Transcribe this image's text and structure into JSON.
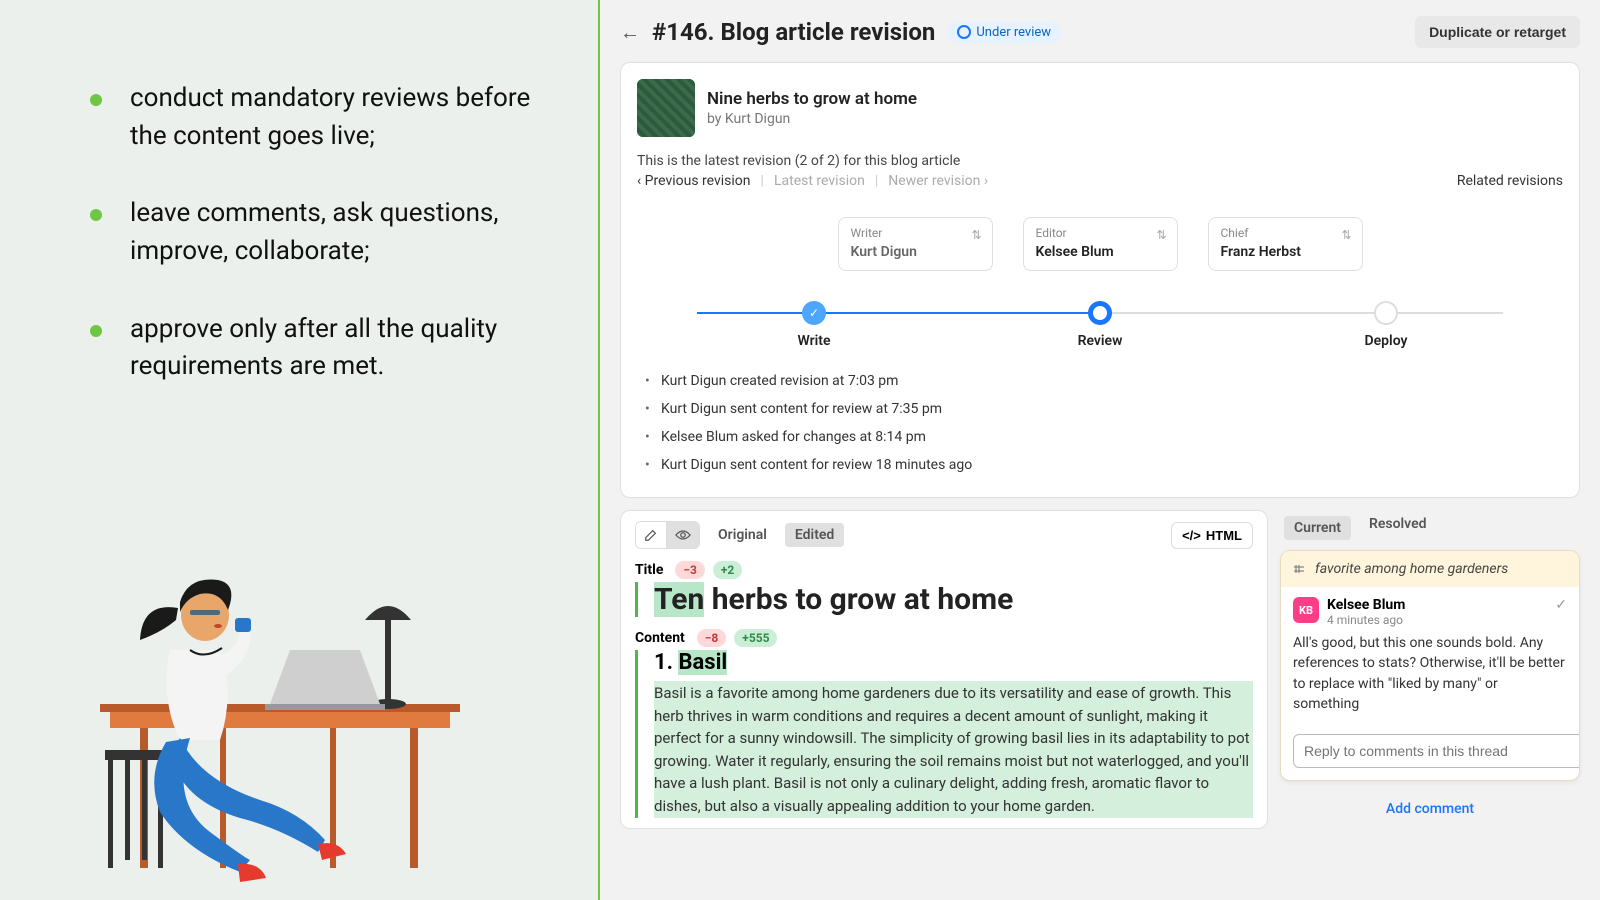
{
  "marketing": {
    "bullets": [
      "conduct mandatory reviews before the content goes live;",
      "leave comments, ask questions, improve, collaborate;",
      "approve only after all the quality requirements are met."
    ]
  },
  "header": {
    "title": "#146. Blog article revision",
    "status": "Under review",
    "duplicate_label": "Duplicate or retarget"
  },
  "article": {
    "title": "Nine herbs to grow at home",
    "byline_prefix": "by ",
    "author": "Kurt Digun"
  },
  "revision": {
    "summary": "This is the latest revision (2 of 2) for this blog article",
    "prev": "‹ Previous revision",
    "latest": "Latest revision",
    "newer": "Newer revision ›",
    "related": "Related revisions"
  },
  "roles": {
    "writer": {
      "label": "Writer",
      "name": "Kurt Digun"
    },
    "editor": {
      "label": "Editor",
      "name": "Kelsee Blum"
    },
    "chief": {
      "label": "Chief",
      "name": "Franz Herbst"
    }
  },
  "steps": [
    "Write",
    "Review",
    "Deploy"
  ],
  "activity": [
    "Kurt Digun created revision at 7:03 pm",
    "Kurt Digun sent content for review at 7:35 pm",
    "Kelsee Blum asked for changes at 8:14 pm",
    "Kurt Digun sent content for review 18 minutes ago"
  ],
  "editor": {
    "tabs": {
      "original": "Original",
      "edited": "Edited"
    },
    "html_btn": "HTML",
    "title": {
      "label": "Title",
      "neg": "−3",
      "pos": "+2",
      "highlight": "Ten",
      "rest": " herbs to grow at home"
    },
    "content": {
      "label": "Content",
      "neg": "−8",
      "pos": "+555",
      "h_plain": "1. ",
      "h_highlight": "Basil",
      "paragraph": "Basil is a favorite among home gardeners due to its versatility and ease of growth. This herb thrives in warm conditions and requires a decent amount of sunlight, making it perfect for a sunny windowsill. The simplicity of growing basil lies in its adaptability to pot growing. Water it regularly, ensuring the soil remains moist but not waterlogged, and you'll have a lush plant. Basil is not only a culinary delight, adding fresh, aromatic flavor to dishes, but also a visually appealing addition to your home garden."
    }
  },
  "comments": {
    "tabs": {
      "current": "Current",
      "resolved": "Resolved"
    },
    "reference": "favorite among home gardeners",
    "author_initials": "KB",
    "author": "Kelsee Blum",
    "time": "4 minutes ago",
    "text": "All's good, but this one sounds bold. Any references to stats? Otherwise, it'll be better to replace with \"liked by many\" or something",
    "reply_placeholder": "Reply to comments in this thread",
    "add": "Add comment"
  }
}
